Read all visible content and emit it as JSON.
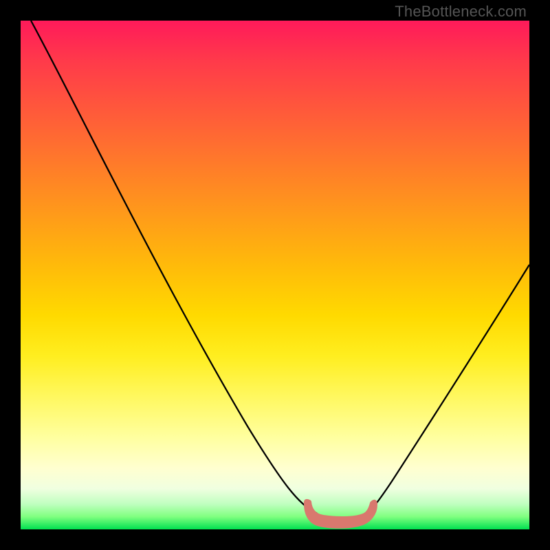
{
  "watermark": "TheBottleneck.com",
  "chart_data": {
    "type": "line",
    "title": "",
    "xlabel": "",
    "ylabel": "",
    "xlim": [
      0,
      100
    ],
    "ylim": [
      0,
      100
    ],
    "series": [
      {
        "name": "bottleneck-curve",
        "x": [
          0,
          5,
          10,
          15,
          20,
          25,
          30,
          35,
          40,
          45,
          50,
          55,
          58,
          60,
          62,
          64,
          66,
          68,
          70,
          75,
          80,
          85,
          90,
          95,
          100
        ],
        "values": [
          100,
          91,
          83,
          75,
          67,
          59,
          51,
          43,
          35,
          27,
          19,
          11,
          6,
          3,
          2,
          2,
          2,
          3,
          6,
          13,
          21,
          29,
          38,
          48,
          58
        ],
        "color": "#000000"
      },
      {
        "name": "sweet-spot-band",
        "x": [
          55,
          57,
          59,
          61,
          63,
          65,
          67,
          69
        ],
        "values": [
          6,
          3,
          2.2,
          2,
          2,
          2.2,
          3,
          5.5
        ],
        "color": "#d9786e"
      }
    ],
    "gradient_stops": [
      {
        "pos": 0.0,
        "color": "#ff1a5a"
      },
      {
        "pos": 0.5,
        "color": "#ffda00"
      },
      {
        "pos": 0.9,
        "color": "#ffffd0"
      },
      {
        "pos": 1.0,
        "color": "#00e050"
      }
    ]
  }
}
